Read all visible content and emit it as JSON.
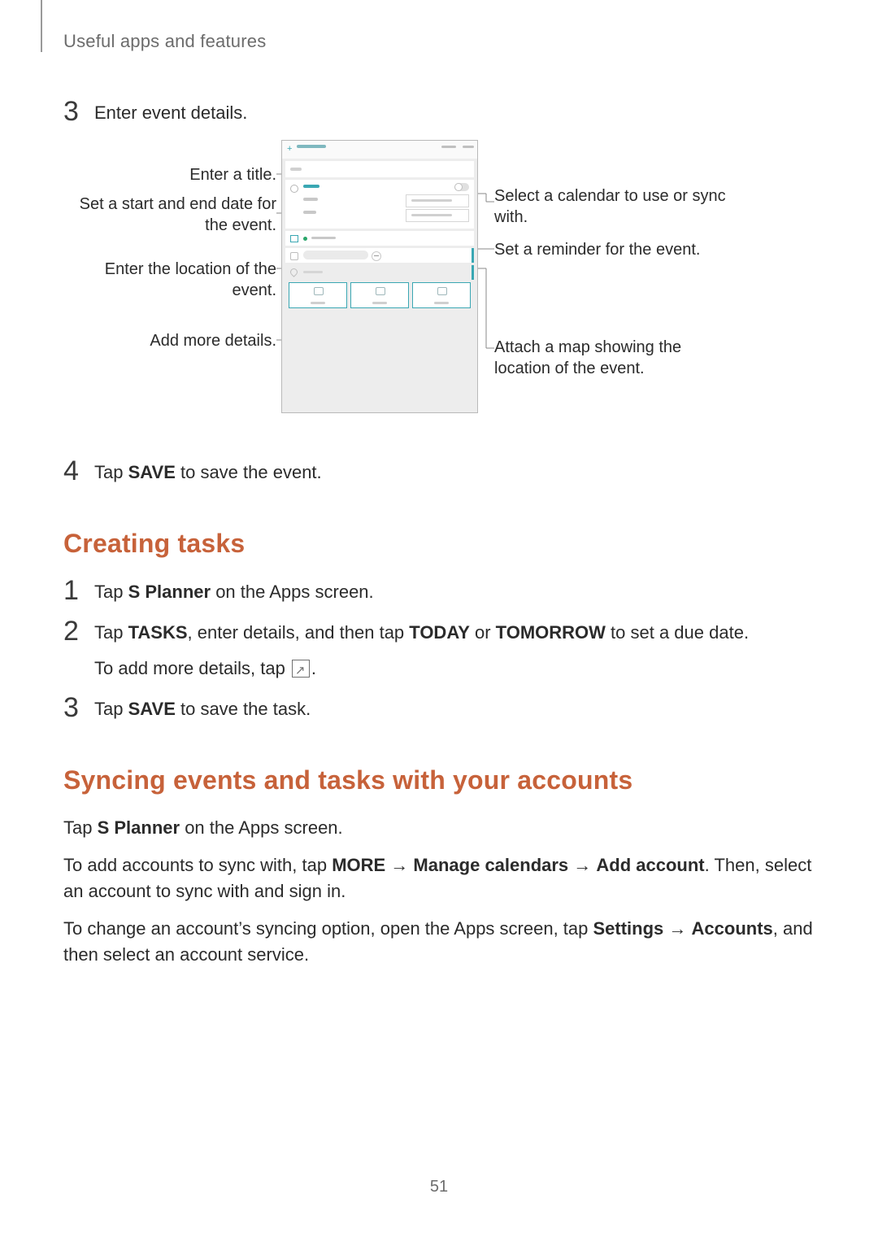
{
  "breadcrumb": "Useful apps and features",
  "step3": {
    "num": "3",
    "text": "Enter event details."
  },
  "diagram": {
    "left": {
      "title": "Enter a title.",
      "dates": "Set a start and end date for the event.",
      "location": "Enter the location of the event.",
      "more": "Add more details."
    },
    "right": {
      "calendar": "Select a calendar to use or sync with.",
      "reminder": "Set a reminder for the event.",
      "map": "Attach a map showing the location of the event."
    }
  },
  "step4": {
    "num": "4",
    "pre": "Tap ",
    "bold": "SAVE",
    "post": " to save the event."
  },
  "creating_tasks": {
    "heading": "Creating tasks",
    "s1": {
      "num": "1",
      "pre": "Tap ",
      "b1": "S Planner",
      "post": " on the Apps screen."
    },
    "s2": {
      "num": "2",
      "pre": "Tap ",
      "b1": "TASKS",
      "mid1": ", enter details, and then tap ",
      "b2": "TODAY",
      "mid2": " or ",
      "b3": "TOMORROW",
      "post": " to set a due date.",
      "sub_pre": "To add more details, tap ",
      "sub_post": "."
    },
    "s3": {
      "num": "3",
      "pre": "Tap ",
      "b1": "SAVE",
      "post": " to save the task."
    }
  },
  "syncing": {
    "heading": "Syncing events and tasks with your accounts",
    "p1_pre": "Tap ",
    "p1_b": "S Planner",
    "p1_post": " on the Apps screen.",
    "p2_pre": "To add accounts to sync with, tap ",
    "p2_b1": "MORE",
    "p2_arrow1": " → ",
    "p2_b2": "Manage calendars",
    "p2_arrow2": " → ",
    "p2_b3": "Add account",
    "p2_post": ". Then, select an account to sync with and sign in.",
    "p3_pre": "To change an account’s syncing option, open the Apps screen, tap ",
    "p3_b1": "Settings",
    "p3_arrow": " → ",
    "p3_b2": "Accounts",
    "p3_post": ", and then select an account service."
  },
  "page_number": "51"
}
